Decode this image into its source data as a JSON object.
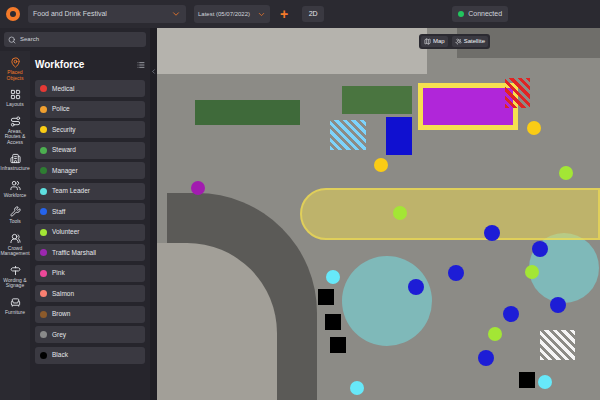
{
  "topbar": {
    "project": "Food and Drink Festival",
    "version": "Latest (05/07/2022)",
    "add": "+",
    "view_mode": "2D",
    "status": "Connected",
    "status_color": "#22c55e"
  },
  "search": {
    "placeholder": "Search"
  },
  "rail": [
    {
      "label": "Placed Objects",
      "selected": true
    },
    {
      "label": "Layouts",
      "selected": false
    },
    {
      "label": "Areas, Routes & Access",
      "selected": false
    },
    {
      "label": "Infrastructure",
      "selected": false
    },
    {
      "label": "Workforce",
      "selected": false
    },
    {
      "label": "Tools",
      "selected": false
    },
    {
      "label": "Crowd Management",
      "selected": false
    },
    {
      "label": "Wording & Signage",
      "selected": false
    },
    {
      "label": "Furniture",
      "selected": false
    }
  ],
  "panel": {
    "title": "Workforce",
    "items": [
      {
        "label": "Medical",
        "color": "#e53935"
      },
      {
        "label": "Police",
        "color": "#f0a030"
      },
      {
        "label": "Security",
        "color": "#facc15"
      },
      {
        "label": "Steward",
        "color": "#4caf50"
      },
      {
        "label": "Manager",
        "color": "#2e7d32"
      },
      {
        "label": "Team Leader",
        "color": "#5ee0e0"
      },
      {
        "label": "Staff",
        "color": "#2563eb"
      },
      {
        "label": "Volunteer",
        "color": "#a3e635"
      },
      {
        "label": "Traffic Marshall",
        "color": "#9c27b0"
      },
      {
        "label": "Pink",
        "color": "#ec4899"
      },
      {
        "label": "Salmon",
        "color": "#fa8072"
      },
      {
        "label": "Brown",
        "color": "#8b5a2b"
      },
      {
        "label": "Grey",
        "color": "#8a8a8a"
      },
      {
        "label": "Black",
        "color": "#000000"
      }
    ]
  },
  "map": {
    "buttons": [
      {
        "label": "Map"
      },
      {
        "label": "Satellite"
      }
    ],
    "objects": [
      {
        "kind": "area",
        "color": "#f5e050"
      },
      {
        "kind": "zone",
        "color": "#b026d9"
      },
      {
        "kind": "hatch",
        "color": "#e02424"
      },
      {
        "kind": "rect",
        "color": "#1010d0"
      },
      {
        "kind": "hatch",
        "color": "#7dd3fc"
      },
      {
        "kind": "dot",
        "color": "#a21caf"
      },
      {
        "kind": "dot",
        "color": "#facc15"
      },
      {
        "kind": "dot",
        "color": "#facc15"
      },
      {
        "kind": "dot",
        "color": "#a3e635"
      },
      {
        "kind": "dot",
        "color": "#a3e635"
      },
      {
        "kind": "dot",
        "color": "#a3e635"
      },
      {
        "kind": "dot",
        "color": "#a3e635"
      },
      {
        "kind": "dot",
        "color": "#1d1dd6"
      },
      {
        "kind": "dot",
        "color": "#1d1dd6"
      },
      {
        "kind": "dot",
        "color": "#1d1dd6"
      },
      {
        "kind": "dot",
        "color": "#1d1dd6"
      },
      {
        "kind": "dot",
        "color": "#1d1dd6"
      },
      {
        "kind": "dot",
        "color": "#1d1dd6"
      },
      {
        "kind": "dot",
        "color": "#1d1dd6"
      },
      {
        "kind": "dot",
        "color": "#67e8f9"
      },
      {
        "kind": "dot",
        "color": "#67e8f9"
      },
      {
        "kind": "dot",
        "color": "#67e8f9"
      },
      {
        "kind": "square",
        "color": "#000000"
      },
      {
        "kind": "square",
        "color": "#000000"
      },
      {
        "kind": "square",
        "color": "#000000"
      },
      {
        "kind": "square",
        "color": "#000000"
      },
      {
        "kind": "hatch",
        "color": "#f5f5f5"
      }
    ]
  }
}
